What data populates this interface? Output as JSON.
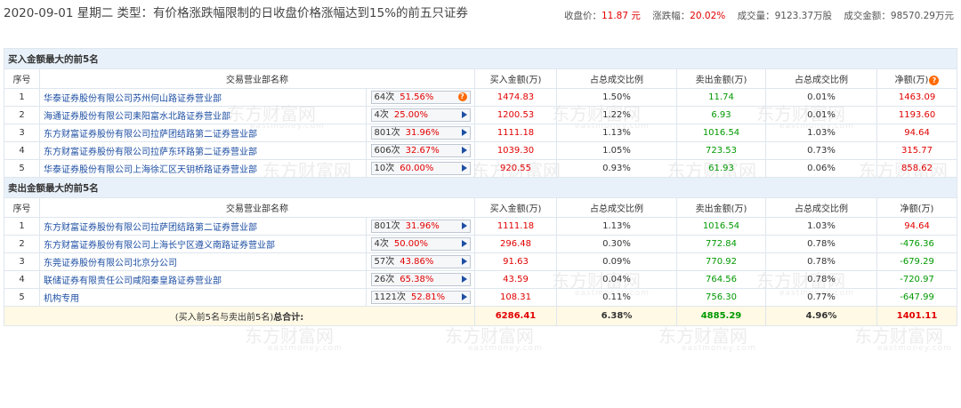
{
  "header": {
    "title": "2020-09-01 星期二  类型：有价格涨跌幅限制的日收盘价格涨幅达到15%的前五只证券",
    "close_label": "收盘价：",
    "close_value": "11.87 元",
    "change_label": "涨跌幅：",
    "change_value": "20.02%",
    "volume_label": "成交量：",
    "volume_value": "9123.37万股",
    "amount_label": "成交金额：",
    "amount_value": "98570.29万元"
  },
  "watermark": {
    "cn": "东方财富网",
    "en": "eastmoney.com"
  },
  "columns": {
    "index": "序号",
    "dept": "交易营业部名称",
    "buy": "买入金额(万)",
    "buy_ratio": "占总成交比例",
    "sell": "卖出金额(万)",
    "sell_ratio": "占总成交比例",
    "net": "净额(万)"
  },
  "buy_section": {
    "title": "买入金额最大的前5名",
    "rows": [
      {
        "idx": "1",
        "name": "华泰证券股份有限公司苏州何山路证券营业部",
        "count": "64次",
        "pct": "51.56%",
        "buy": "1474.83",
        "buy_ratio": "1.50%",
        "sell": "11.74",
        "sell_ratio": "0.01%",
        "net": "1463.09"
      },
      {
        "idx": "2",
        "name": "海通证券股份有限公司耒阳富水北路证券营业部",
        "count": "4次",
        "pct": "25.00%",
        "buy": "1200.53",
        "buy_ratio": "1.22%",
        "sell": "6.93",
        "sell_ratio": "0.01%",
        "net": "1193.60"
      },
      {
        "idx": "3",
        "name": "东方财富证券股份有限公司拉萨团结路第二证券营业部",
        "count": "801次",
        "pct": "31.96%",
        "buy": "1111.18",
        "buy_ratio": "1.13%",
        "sell": "1016.54",
        "sell_ratio": "1.03%",
        "net": "94.64"
      },
      {
        "idx": "4",
        "name": "东方财富证券股份有限公司拉萨东环路第二证券营业部",
        "count": "606次",
        "pct": "32.67%",
        "buy": "1039.30",
        "buy_ratio": "1.05%",
        "sell": "723.53",
        "sell_ratio": "0.73%",
        "net": "315.77"
      },
      {
        "idx": "5",
        "name": "华泰证券股份有限公司上海徐汇区天钥桥路证券营业部",
        "count": "10次",
        "pct": "60.00%",
        "buy": "920.55",
        "buy_ratio": "0.93%",
        "sell": "61.93",
        "sell_ratio": "0.06%",
        "net": "858.62"
      }
    ]
  },
  "sell_section": {
    "title": "卖出金额最大的前5名",
    "rows": [
      {
        "idx": "1",
        "name": "东方财富证券股份有限公司拉萨团结路第二证券营业部",
        "count": "801次",
        "pct": "31.96%",
        "buy": "1111.18",
        "buy_ratio": "1.13%",
        "sell": "1016.54",
        "sell_ratio": "1.03%",
        "net": "94.64"
      },
      {
        "idx": "2",
        "name": "东方财富证券股份有限公司上海长宁区遵义南路证券营业部",
        "count": "4次",
        "pct": "50.00%",
        "buy": "296.48",
        "buy_ratio": "0.30%",
        "sell": "772.84",
        "sell_ratio": "0.78%",
        "net": "-476.36"
      },
      {
        "idx": "3",
        "name": "东莞证券股份有限公司北京分公司",
        "count": "57次",
        "pct": "43.86%",
        "buy": "91.63",
        "buy_ratio": "0.09%",
        "sell": "770.92",
        "sell_ratio": "0.78%",
        "net": "-679.29"
      },
      {
        "idx": "4",
        "name": "联储证券有限责任公司咸阳秦皇路证券营业部",
        "count": "26次",
        "pct": "65.38%",
        "buy": "43.59",
        "buy_ratio": "0.04%",
        "sell": "764.56",
        "sell_ratio": "0.78%",
        "net": "-720.97"
      },
      {
        "idx": "5",
        "name": "机构专用",
        "count": "1121次",
        "pct": "52.81%",
        "buy": "108.31",
        "buy_ratio": "0.11%",
        "sell": "756.30",
        "sell_ratio": "0.77%",
        "net": "-647.99"
      }
    ]
  },
  "total": {
    "label_prefix": "(买入前5名与卖出前5名)",
    "label_bold": "总合计:",
    "buy": "6286.41",
    "buy_ratio": "6.38%",
    "sell": "4885.29",
    "sell_ratio": "4.96%",
    "net": "1401.11"
  },
  "colors": {
    "up": "#e10000",
    "down": "#009900",
    "link": "#1e4fa3",
    "section_bg": "#e8f1fa",
    "total_bg": "#fff9e5"
  },
  "icons": {
    "info": "question-circle-icon",
    "expand": "triangle-right-icon"
  }
}
